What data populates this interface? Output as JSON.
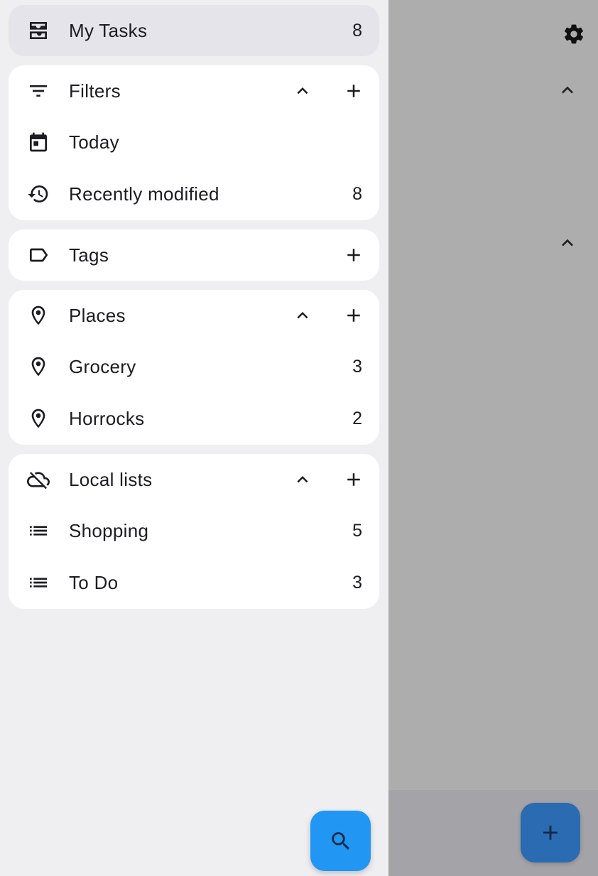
{
  "drawer": {
    "my_tasks": {
      "label": "My Tasks",
      "count": "8",
      "icon": "inbox-icon"
    },
    "filters": {
      "header": {
        "label": "Filters",
        "icon": "filter-icon"
      },
      "items": [
        {
          "label": "Today",
          "count": "",
          "icon": "calendar-today-icon"
        },
        {
          "label": "Recently modified",
          "count": "8",
          "icon": "history-icon"
        }
      ]
    },
    "tags": {
      "header": {
        "label": "Tags",
        "icon": "label-icon"
      }
    },
    "places": {
      "header": {
        "label": "Places",
        "icon": "place-icon"
      },
      "items": [
        {
          "label": "Grocery",
          "count": "3",
          "icon": "place-icon"
        },
        {
          "label": "Horrocks",
          "count": "2",
          "icon": "place-icon"
        }
      ]
    },
    "local_lists": {
      "header": {
        "label": "Local lists",
        "icon": "cloud-off-icon"
      },
      "items": [
        {
          "label": "Shopping",
          "count": "5",
          "icon": "list-icon"
        },
        {
          "label": "To Do",
          "count": "3",
          "icon": "list-icon"
        }
      ]
    },
    "search_fab": {
      "icon": "search-icon"
    }
  },
  "background": {
    "settings": {
      "icon": "gear-icon"
    },
    "add_fab": {
      "icon": "plus-icon"
    }
  },
  "colors": {
    "drawer_bg": "#efeff1",
    "card_bg": "#ffffff",
    "selected_bg": "#e4e4ea",
    "scrim": "#adadae",
    "fab_search": "#2196f3",
    "fab_add": "#2a6bb2"
  }
}
